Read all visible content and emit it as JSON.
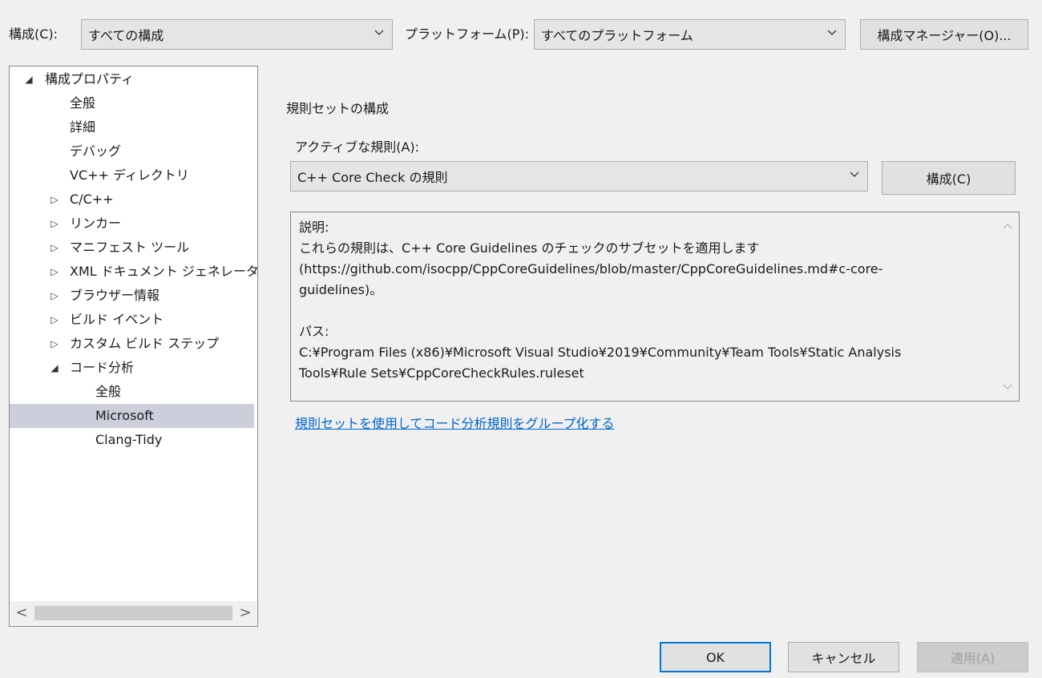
{
  "top": {
    "config_label": "構成(C):",
    "config_value": "すべての構成",
    "platform_label": "プラットフォーム(P):",
    "platform_value": "すべてのプラットフォーム",
    "config_manager_button": "構成マネージャー(O)..."
  },
  "tree": {
    "items": [
      {
        "label": "構成プロパティ",
        "glyph": "◢"
      },
      {
        "label": "全般",
        "glyph": ""
      },
      {
        "label": "詳細",
        "glyph": ""
      },
      {
        "label": "デバッグ",
        "glyph": ""
      },
      {
        "label": "VC++ ディレクトリ",
        "glyph": ""
      },
      {
        "label": "C/C++",
        "glyph": "▷"
      },
      {
        "label": "リンカー",
        "glyph": "▷"
      },
      {
        "label": "マニフェスト ツール",
        "glyph": "▷"
      },
      {
        "label": "XML ドキュメント ジェネレーター",
        "glyph": "▷"
      },
      {
        "label": "ブラウザー情報",
        "glyph": "▷"
      },
      {
        "label": "ビルド イベント",
        "glyph": "▷"
      },
      {
        "label": "カスタム ビルド ステップ",
        "glyph": "▷"
      },
      {
        "label": "コード分析",
        "glyph": "◢"
      },
      {
        "label": "全般",
        "glyph": ""
      },
      {
        "label": "Microsoft",
        "glyph": ""
      },
      {
        "label": "Clang-Tidy",
        "glyph": ""
      }
    ],
    "scroll_left": "<",
    "scroll_right": ">"
  },
  "main": {
    "section_title": "規則セットの構成",
    "active_rules_label": "アクティブな規則(A):",
    "active_rules_value": "C++ Core Check の規則",
    "configure_button": "構成(C)",
    "description": {
      "heading": "説明:",
      "line1": "これらの規則は、C++ Core Guidelines のチェックのサブセットを適用します",
      "line2": "(https://github.com/isocpp/CppCoreGuidelines/blob/master/CppCoreGuidelines.md#c-core-",
      "line3": "guidelines)。",
      "path_heading": "パス:",
      "path_line1": "C:¥Program Files (x86)¥Microsoft Visual Studio¥2019¥Community¥Team Tools¥Static Analysis",
      "path_line2": "Tools¥Rule Sets¥CppCoreCheckRules.ruleset"
    },
    "link": "規則セットを使用してコード分析規則をグループ化する"
  },
  "buttons": {
    "ok": "OK",
    "cancel": "キャンセル",
    "apply": "適用(A)"
  }
}
